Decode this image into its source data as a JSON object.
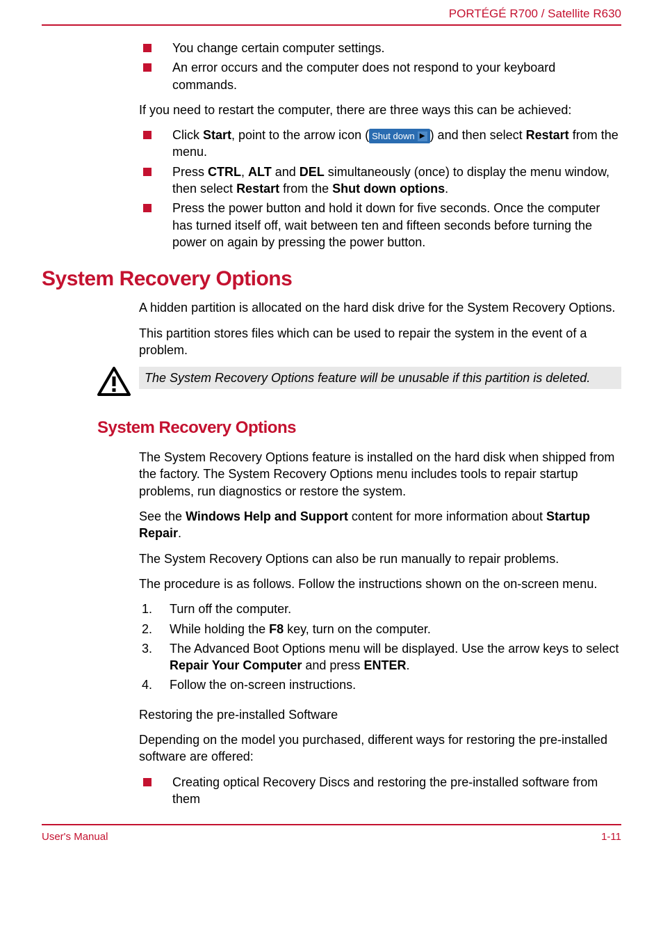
{
  "header": {
    "product": "PORTÉGÉ R700 / Satellite R630"
  },
  "intro": {
    "list1": [
      "You change certain computer settings.",
      "An error occurs and the computer does not respond to your keyboard commands."
    ],
    "p1": "If you need to restart the computer, there are three ways this can be achieved:",
    "list2_item1_pre": "Click ",
    "list2_item1_start": "Start",
    "list2_item1_mid": ", point to the arrow icon (",
    "shutdown_label": "Shut down",
    "list2_item1_post": ") and then select ",
    "list2_item1_restart": "Restart",
    "list2_item1_end": " from the menu.",
    "list2_item2_pre": "Press ",
    "list2_item2_ctrl": "CTRL",
    "list2_item2_c1": ", ",
    "list2_item2_alt": "ALT",
    "list2_item2_c2": " and ",
    "list2_item2_del": "DEL",
    "list2_item2_mid": " simultaneously (once) to display the menu window, then select ",
    "list2_item2_restart": "Restart",
    "list2_item2_from": " from the ",
    "list2_item2_sdo": "Shut down options",
    "list2_item2_dot": ".",
    "list2_item3": "Press the power button and hold it down for five seconds. Once the computer has turned itself off, wait between ten and fifteen seconds before turning the power on again by pressing the power button."
  },
  "section1": {
    "title": "System Recovery Options",
    "p1": "A hidden partition is allocated on the hard disk drive for the System Recovery Options.",
    "p2": "This partition stores files which can be used to repair the system in the event of a problem.",
    "callout": "The System Recovery Options feature will be unusable if this partition is deleted."
  },
  "section2": {
    "title": "System Recovery Options",
    "p1": "The System Recovery Options feature is installed on the hard disk when shipped from the factory. The System Recovery Options menu includes tools to repair startup problems, run diagnostics or restore the system.",
    "p2_pre": "See the ",
    "p2_bold": "Windows Help and Support",
    "p2_mid": " content for more information about ",
    "p2_bold2": "Startup Repair",
    "p2_end": ".",
    "p3": "The System Recovery Options can also be run manually to repair problems.",
    "p4": "The procedure is as follows. Follow the instructions shown on the on-screen menu.",
    "steps": {
      "s1": "Turn off the computer.",
      "s2_pre": "While holding the ",
      "s2_f8": "F8",
      "s2_post": " key, turn on the computer.",
      "s3_pre": "The Advanced Boot Options menu will be displayed. Use the arrow keys to select ",
      "s3_bold1": "Repair Your Computer",
      "s3_mid": " and press ",
      "s3_bold2": "ENTER",
      "s3_end": ".",
      "s4": "Follow the on-screen instructions."
    },
    "subtitle": "Restoring the pre-installed Software",
    "p5": "Depending on the model you purchased, different ways for restoring the pre-installed software are offered:",
    "list3_item1": "Creating optical Recovery Discs and restoring the pre-installed software from them"
  },
  "footer": {
    "left": "User's Manual",
    "right": "1-11"
  }
}
